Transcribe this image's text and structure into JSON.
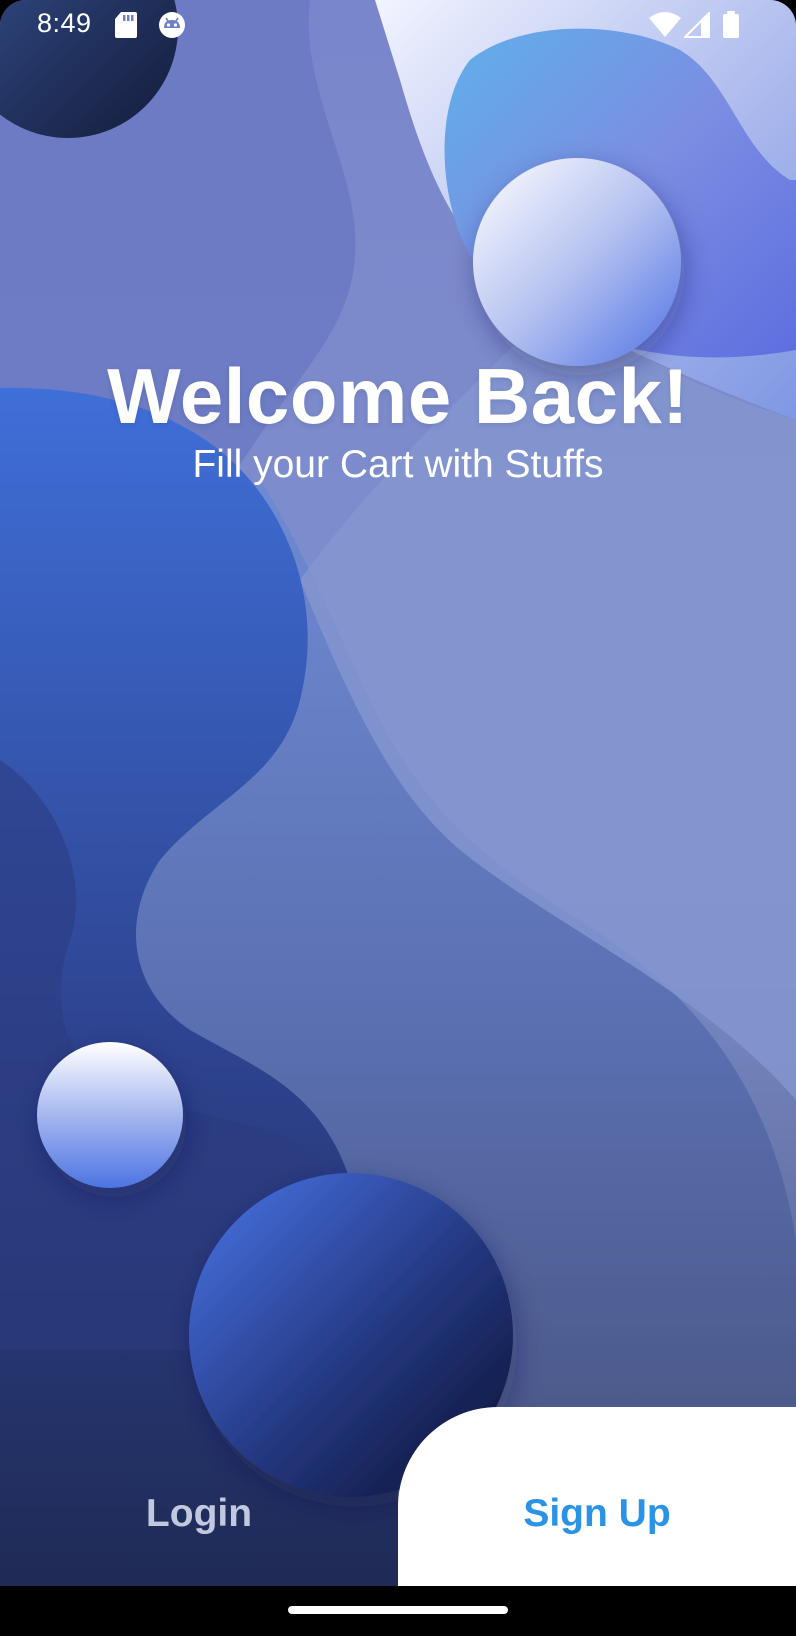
{
  "status_bar": {
    "time": "8:49",
    "icons": [
      "sd-card-icon",
      "android-debug-icon",
      "wifi-icon",
      "cellular-signal-icon",
      "battery-icon"
    ]
  },
  "header": {
    "title": "Welcome Back!",
    "subtitle": "Fill your Cart with Stuffs"
  },
  "auth": {
    "login_label": "Login",
    "signup_label": "Sign Up"
  },
  "colors": {
    "signup_accent": "#2b93e6",
    "login_text": "#c2c9de",
    "background_blue": "#7a86cb"
  }
}
